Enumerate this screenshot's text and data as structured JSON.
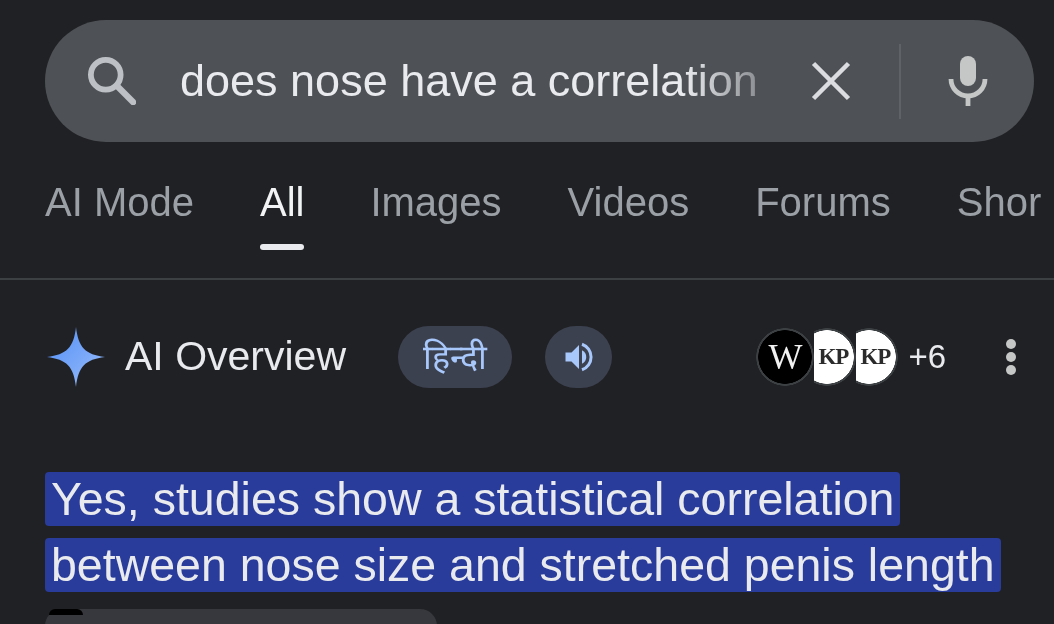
{
  "search": {
    "query": "does nose have a correlation"
  },
  "tabs": [
    {
      "label": "AI Mode",
      "selected": false
    },
    {
      "label": "All",
      "selected": true
    },
    {
      "label": "Images",
      "selected": false
    },
    {
      "label": "Videos",
      "selected": false
    },
    {
      "label": "Forums",
      "selected": false
    },
    {
      "label": "Shor",
      "selected": false
    }
  ],
  "ai_overview": {
    "title": "AI Overview",
    "language_button": "हिन्दी",
    "sources": [
      {
        "kind": "dark",
        "mark": "W"
      },
      {
        "kind": "light",
        "mark": "KP"
      },
      {
        "kind": "light",
        "mark": "KP"
      }
    ],
    "more_sources": "+6",
    "summary": {
      "text": "Yes, studies show a statistical correlation between nose size and stretched penis length",
      "highlighted": true
    }
  }
}
